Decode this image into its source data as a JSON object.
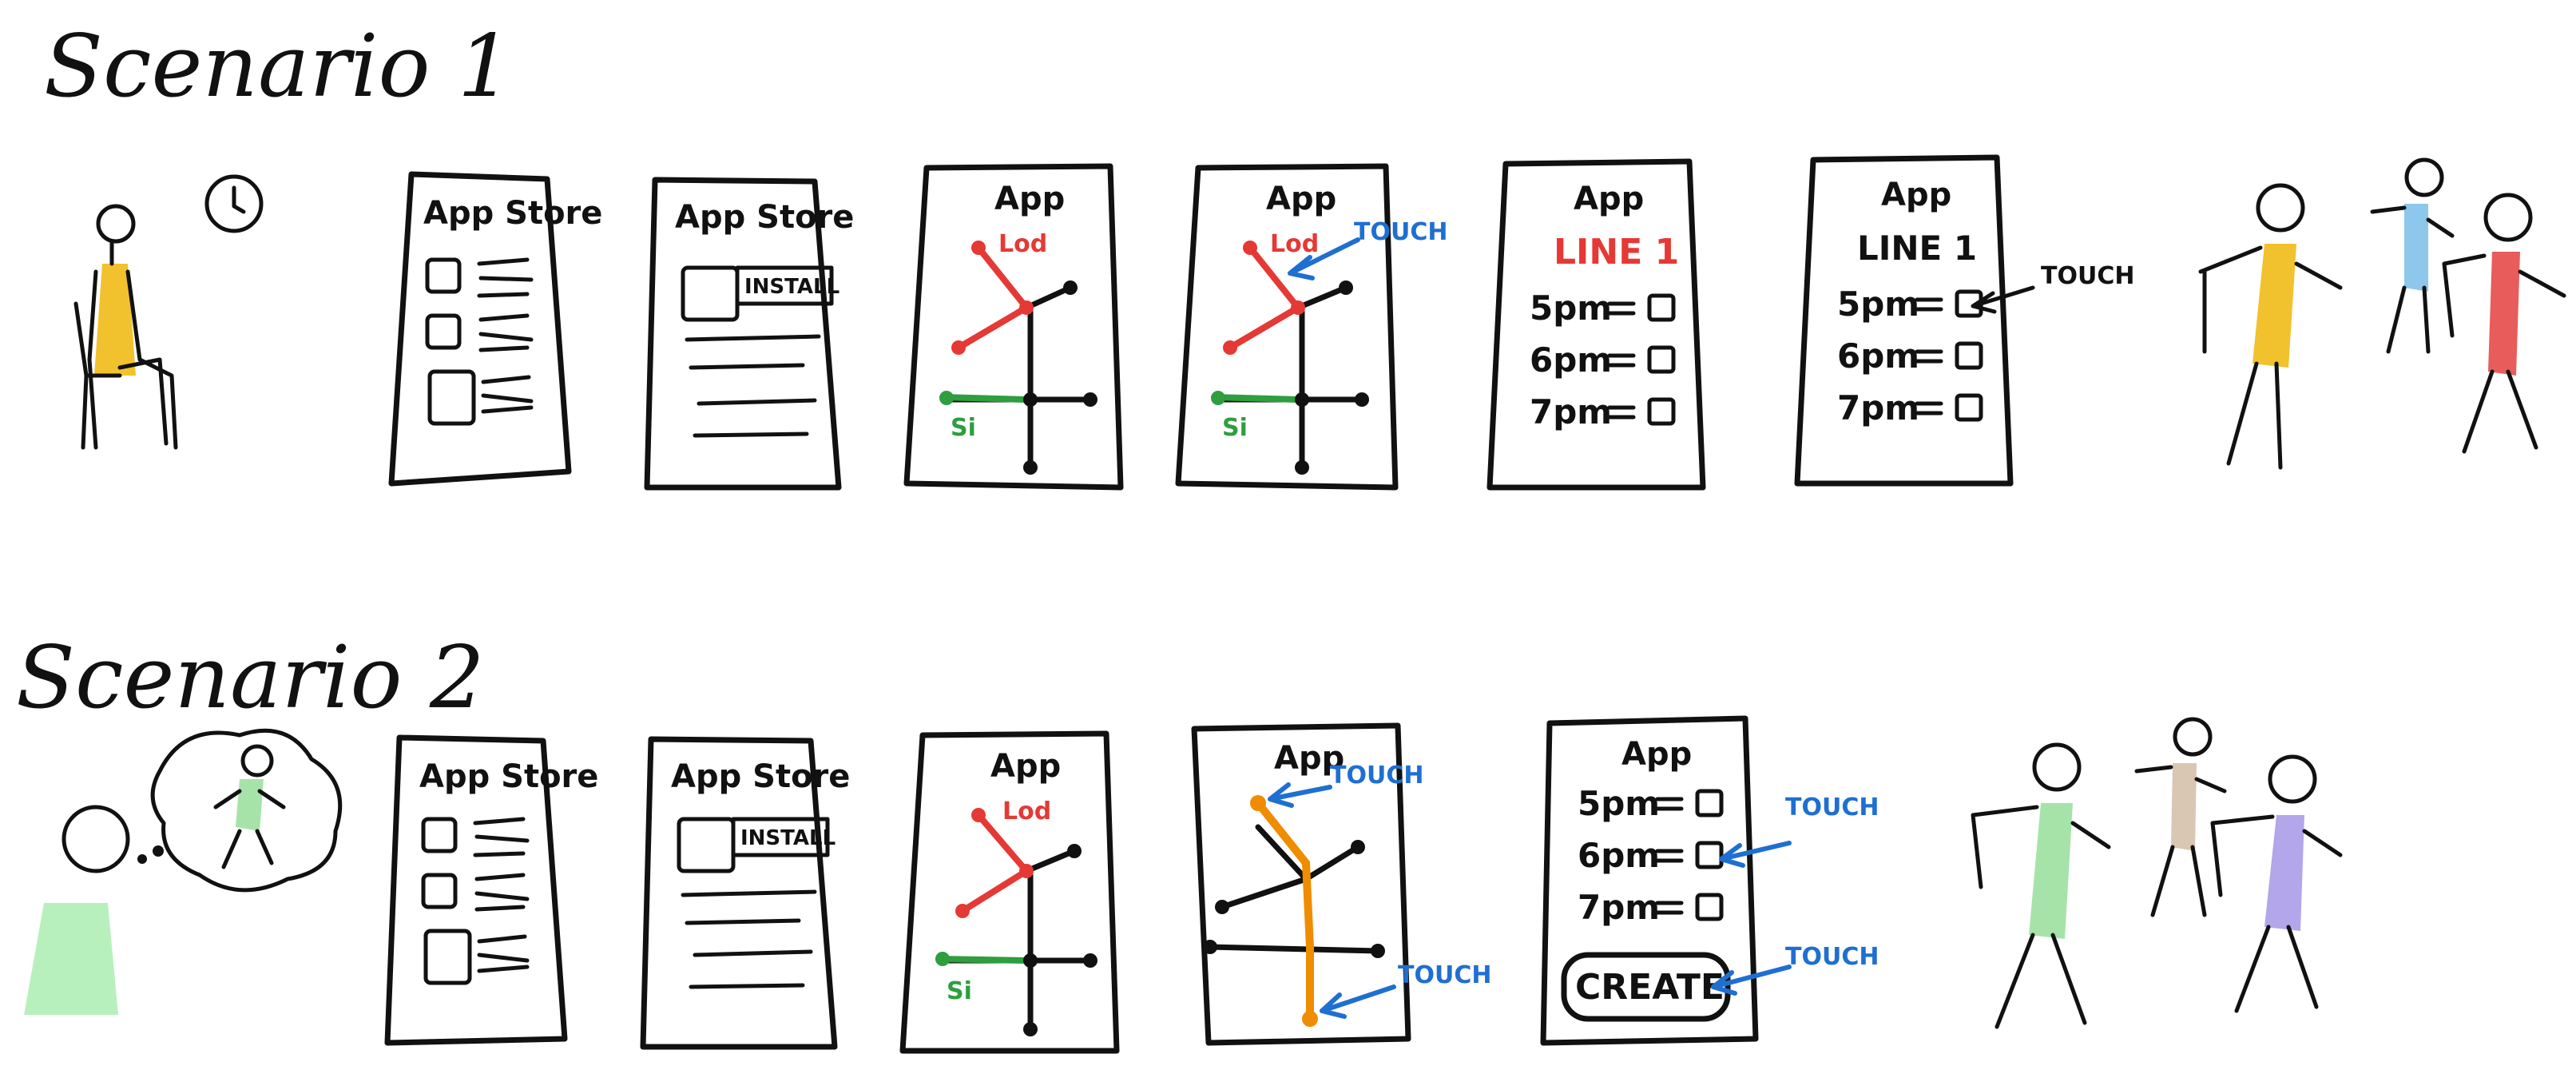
{
  "colors": {
    "ink": "#111111",
    "red_line": "#e53935",
    "green_line": "#2e9e3f",
    "touch_blue": "#1f6fd1",
    "orange_route": "#f08c00",
    "person_yellow": "#f2c12e",
    "person_blue": "#8ec7ec",
    "person_red": "#e85c5c",
    "person_green": "#a6e3a9",
    "person_beige": "#d9c6b3",
    "person_purple": "#b3a6ea",
    "waiting_green": "#b8f0bd"
  },
  "scenarios": [
    {
      "title": "Scenario 1",
      "screens": [
        {
          "kind": "store_list",
          "header": "App Store"
        },
        {
          "kind": "store_install",
          "header": "App Store",
          "button": "INSTALL"
        },
        {
          "kind": "map",
          "header": "App",
          "red_label": "Lod",
          "green_label": "Si"
        },
        {
          "kind": "map_touch",
          "header": "App",
          "red_label": "Lod",
          "green_label": "Si",
          "touch": "TOUCH"
        },
        {
          "kind": "schedule",
          "header": "App",
          "line": "LINE 1",
          "rows": [
            "5pm",
            "6pm",
            "7pm"
          ]
        },
        {
          "kind": "schedule_touch",
          "header": "App",
          "line": "LINE 1",
          "rows": [
            "5pm",
            "6pm",
            "7pm"
          ],
          "touch": "TOUCH"
        }
      ],
      "people_icons": [
        "clock-icon"
      ]
    },
    {
      "title": "Scenario 2",
      "screens": [
        {
          "kind": "store_list",
          "header": "App Store"
        },
        {
          "kind": "store_install",
          "header": "App Store",
          "button": "INSTALL"
        },
        {
          "kind": "map",
          "header": "App",
          "red_label": "Lod",
          "green_label": "Si"
        },
        {
          "kind": "route_touch",
          "header": "App",
          "touch_top": "TOUCH",
          "touch_bottom": "TOUCH"
        },
        {
          "kind": "create",
          "header": "App",
          "rows": [
            "5pm",
            "6pm",
            "7pm"
          ],
          "button": "CREATE",
          "touch_row": "TOUCH",
          "touch_button": "TOUCH"
        }
      ],
      "people_icons": [
        "thought-bubble-icon"
      ]
    }
  ]
}
